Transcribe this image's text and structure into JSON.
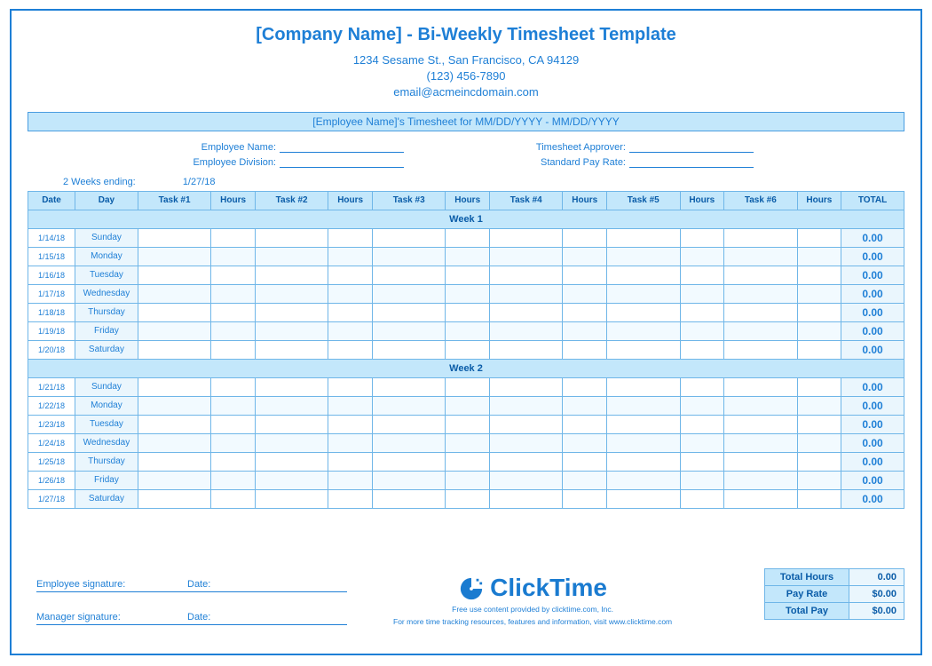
{
  "title": "[Company Name] - Bi-Weekly Timesheet Template",
  "company": {
    "address": "1234 Sesame St.,  San Francisco, CA 94129",
    "phone": "(123) 456-7890",
    "email": "email@acmeincdomain.com"
  },
  "period_bar": "[Employee Name]'s Timesheet for MM/DD/YYYY - MM/DD/YYYY",
  "info": {
    "emp_name_label": "Employee Name:",
    "emp_div_label": "Employee Division:",
    "approver_label": "Timesheet Approver:",
    "payrate_label": "Standard Pay Rate:"
  },
  "ending": {
    "label": "2 Weeks ending:",
    "value": "1/27/18"
  },
  "headers": {
    "date": "Date",
    "day": "Day",
    "task1": "Task #1",
    "task2": "Task #2",
    "task3": "Task #3",
    "task4": "Task #4",
    "task5": "Task #5",
    "task6": "Task #6",
    "hours": "Hours",
    "total": "TOTAL"
  },
  "week1_label": "Week 1",
  "week2_label": "Week 2",
  "week1": [
    {
      "date": "1/14/18",
      "day": "Sunday",
      "total": "0.00"
    },
    {
      "date": "1/15/18",
      "day": "Monday",
      "total": "0.00"
    },
    {
      "date": "1/16/18",
      "day": "Tuesday",
      "total": "0.00"
    },
    {
      "date": "1/17/18",
      "day": "Wednesday",
      "total": "0.00"
    },
    {
      "date": "1/18/18",
      "day": "Thursday",
      "total": "0.00"
    },
    {
      "date": "1/19/18",
      "day": "Friday",
      "total": "0.00"
    },
    {
      "date": "1/20/18",
      "day": "Saturday",
      "total": "0.00"
    }
  ],
  "week2": [
    {
      "date": "1/21/18",
      "day": "Sunday",
      "total": "0.00"
    },
    {
      "date": "1/22/18",
      "day": "Monday",
      "total": "0.00"
    },
    {
      "date": "1/23/18",
      "day": "Tuesday",
      "total": "0.00"
    },
    {
      "date": "1/24/18",
      "day": "Wednesday",
      "total": "0.00"
    },
    {
      "date": "1/25/18",
      "day": "Thursday",
      "total": "0.00"
    },
    {
      "date": "1/26/18",
      "day": "Friday",
      "total": "0.00"
    },
    {
      "date": "1/27/18",
      "day": "Saturday",
      "total": "0.00"
    }
  ],
  "totals": {
    "hours_label": "Total Hours",
    "hours_val": "0.00",
    "rate_label": "Pay Rate",
    "rate_val": "$0.00",
    "pay_label": "Total Pay",
    "pay_val": "$0.00"
  },
  "sig": {
    "emp_label": "Employee signature:",
    "mgr_label": "Manager signature:",
    "date_label": "Date:"
  },
  "brand": {
    "name": "ClickTime",
    "line1": "Free use content provided by clicktime.com, Inc.",
    "line2": "For more time tracking resources, features and information, visit www.clicktime.com"
  }
}
